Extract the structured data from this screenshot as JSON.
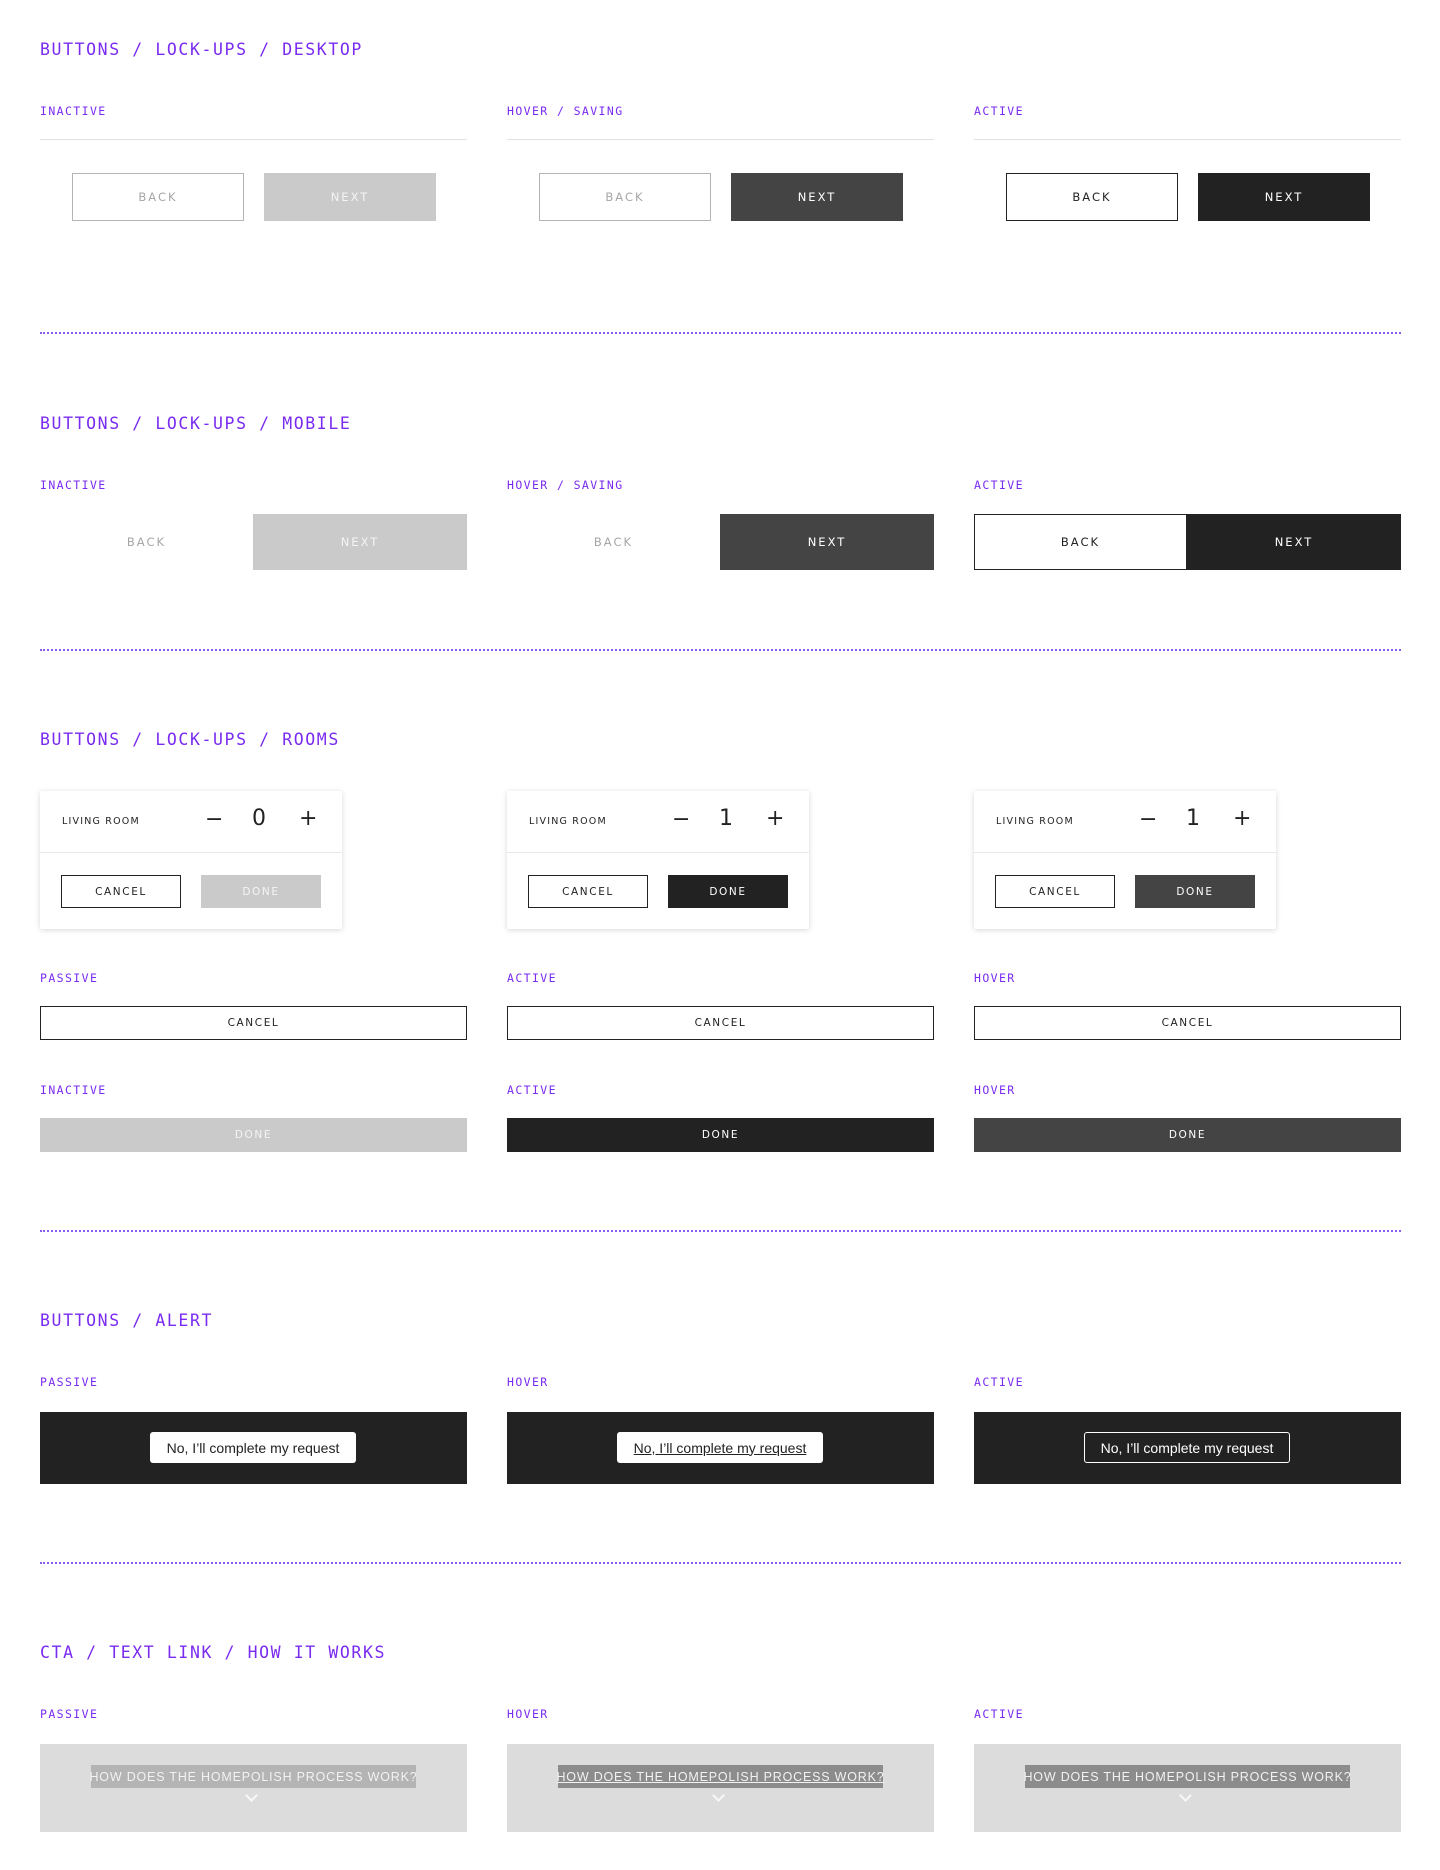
{
  "sections": {
    "desktop": {
      "title": "BUTTONS / LOCK-UPS / DESKTOP"
    },
    "mobile": {
      "title": "BUTTONS / LOCK-UPS / MOBILE"
    },
    "rooms": {
      "title": "BUTTONS / LOCK-UPS / ROOMS"
    },
    "alert": {
      "title": "BUTTONS / ALERT"
    },
    "cta": {
      "title": "CTA / TEXT LINK / HOW IT WORKS"
    }
  },
  "states": {
    "inactive": "INACTIVE",
    "hover_saving": "HOVER / SAVING",
    "active": "ACTIVE",
    "passive": "PASSIVE",
    "hover": "HOVER"
  },
  "buttons": {
    "back": "BACK",
    "next": "NEXT",
    "cancel": "CANCEL",
    "done": "DONE"
  },
  "rooms": {
    "label": "LIVING ROOM",
    "minus": "−",
    "plus": "+",
    "cards": [
      {
        "count": "0",
        "state": "inactive"
      },
      {
        "count": "1",
        "state": "active"
      },
      {
        "count": "1",
        "state": "hover"
      }
    ]
  },
  "alert": {
    "dismiss": "No, I’ll complete my request"
  },
  "cta": {
    "link": "HOW DOES THE HOMEPOLISH PROCESS WORK?"
  },
  "colors": {
    "accent": "#7a2bf0",
    "dark": "#222222",
    "hover": "#444444",
    "disabled": "#cacaca"
  }
}
